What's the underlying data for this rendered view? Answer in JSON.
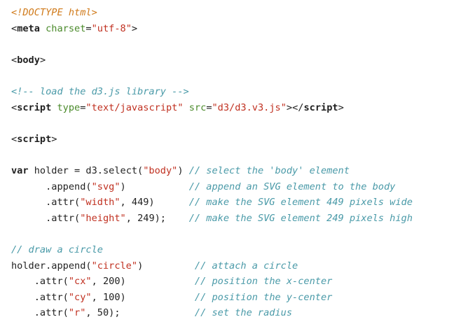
{
  "lines": [
    [
      {
        "t": "meta",
        "v": "<!DOCTYPE html>"
      }
    ],
    [
      {
        "t": "pln",
        "v": "<"
      },
      {
        "t": "tag",
        "v": "meta"
      },
      {
        "t": "pln",
        "v": " "
      },
      {
        "t": "attr",
        "v": "charset"
      },
      {
        "t": "pln",
        "v": "="
      },
      {
        "t": "str",
        "v": "\"utf-8\""
      },
      {
        "t": "pln",
        "v": ">"
      }
    ],
    [],
    [
      {
        "t": "pln",
        "v": "<"
      },
      {
        "t": "tag",
        "v": "body"
      },
      {
        "t": "pln",
        "v": ">"
      }
    ],
    [],
    [
      {
        "t": "cmt",
        "v": "<!-- load the d3.js library -->"
      }
    ],
    [
      {
        "t": "pln",
        "v": "<"
      },
      {
        "t": "tag",
        "v": "script"
      },
      {
        "t": "pln",
        "v": " "
      },
      {
        "t": "attr",
        "v": "type"
      },
      {
        "t": "pln",
        "v": "="
      },
      {
        "t": "str",
        "v": "\"text/javascript\""
      },
      {
        "t": "pln",
        "v": " "
      },
      {
        "t": "attr",
        "v": "src"
      },
      {
        "t": "pln",
        "v": "="
      },
      {
        "t": "str",
        "v": "\"d3/d3.v3.js\""
      },
      {
        "t": "pln",
        "v": "></"
      },
      {
        "t": "tag",
        "v": "script"
      },
      {
        "t": "pln",
        "v": ">"
      }
    ],
    [],
    [
      {
        "t": "pln",
        "v": "<"
      },
      {
        "t": "tag",
        "v": "script"
      },
      {
        "t": "pln",
        "v": ">"
      }
    ],
    [],
    [
      {
        "t": "kw",
        "v": "var"
      },
      {
        "t": "pln",
        "v": " holder = d3.select("
      },
      {
        "t": "str",
        "v": "\"body\""
      },
      {
        "t": "pln",
        "v": ") "
      },
      {
        "t": "cmt",
        "v": "// select the 'body' element"
      }
    ],
    [
      {
        "t": "pln",
        "v": "      .append("
      },
      {
        "t": "str",
        "v": "\"svg\""
      },
      {
        "t": "pln",
        "v": ")           "
      },
      {
        "t": "cmt",
        "v": "// append an SVG element to the body"
      }
    ],
    [
      {
        "t": "pln",
        "v": "      .attr("
      },
      {
        "t": "str",
        "v": "\"width\""
      },
      {
        "t": "pln",
        "v": ", 449)      "
      },
      {
        "t": "cmt",
        "v": "// make the SVG element 449 pixels wide"
      }
    ],
    [
      {
        "t": "pln",
        "v": "      .attr("
      },
      {
        "t": "str",
        "v": "\"height\""
      },
      {
        "t": "pln",
        "v": ", 249);    "
      },
      {
        "t": "cmt",
        "v": "// make the SVG element 249 pixels high"
      }
    ],
    [],
    [
      {
        "t": "cmt",
        "v": "// draw a circle"
      }
    ],
    [
      {
        "t": "pln",
        "v": "holder.append("
      },
      {
        "t": "str",
        "v": "\"circle\""
      },
      {
        "t": "pln",
        "v": ")         "
      },
      {
        "t": "cmt",
        "v": "// attach a circle"
      }
    ],
    [
      {
        "t": "pln",
        "v": "    .attr("
      },
      {
        "t": "str",
        "v": "\"cx\""
      },
      {
        "t": "pln",
        "v": ", 200)            "
      },
      {
        "t": "cmt",
        "v": "// position the x-center"
      }
    ],
    [
      {
        "t": "pln",
        "v": "    .attr("
      },
      {
        "t": "str",
        "v": "\"cy\""
      },
      {
        "t": "pln",
        "v": ", 100)            "
      },
      {
        "t": "cmt",
        "v": "// position the y-center"
      }
    ],
    [
      {
        "t": "pln",
        "v": "    .attr("
      },
      {
        "t": "str",
        "v": "\"r\""
      },
      {
        "t": "pln",
        "v": ", 50);             "
      },
      {
        "t": "cmt",
        "v": "// set the radius"
      }
    ]
  ],
  "colors": {
    "background": "#ffffff",
    "doctype": "#d07a1a",
    "tag_keyword": "#1f1f1f",
    "attribute": "#4a8a2a",
    "string": "#c03020",
    "comment": "#4a9aa8",
    "plain": "#222222"
  }
}
